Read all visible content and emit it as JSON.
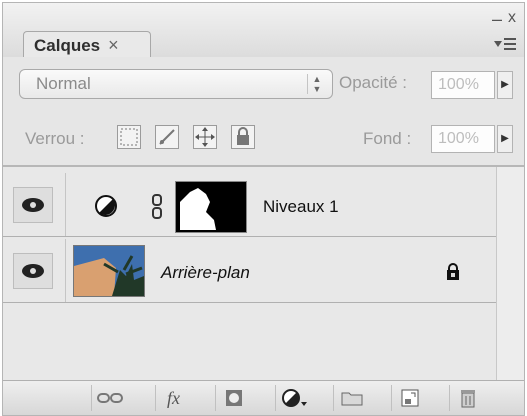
{
  "panel": {
    "tab_label": "Calques",
    "tab_close": "×",
    "close_glyph": "x",
    "min_glyph": "–"
  },
  "blend": {
    "mode": "Normal",
    "opacity_label": "Opacité :",
    "opacity_value": "100%",
    "lock_label": "Verrou :",
    "fill_label": "Fond :",
    "fill_value": "100%"
  },
  "layers": [
    {
      "name": "Niveaux 1",
      "type": "adjustment",
      "visible": true
    },
    {
      "name": "Arrière-plan",
      "type": "background",
      "visible": true,
      "locked": true
    }
  ],
  "bottom_icons": [
    "link-layers-icon",
    "fx-icon",
    "add-mask-icon",
    "new-adjustment-layer-icon",
    "new-group-icon",
    "new-layer-icon",
    "delete-layer-icon"
  ],
  "bottom_fx": "fx",
  "colors": {
    "panel_bg": "#e4e4e4",
    "mask_black": "#000000",
    "mask_white": "#ffffff"
  }
}
